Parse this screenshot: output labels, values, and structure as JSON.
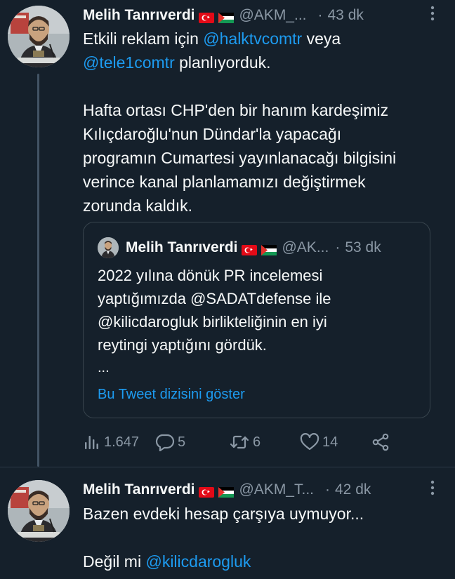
{
  "tweets": [
    {
      "author": {
        "name": "Melih Tanrıverdi",
        "flags": [
          "turkey-flag-icon",
          "palestine-flag-icon"
        ],
        "handle": "@AKM_...",
        "time": "43 dk"
      },
      "more_icon": "more-icon",
      "body": {
        "line1_pre": "Etkili reklam için ",
        "mention1": "@halktvcomtr",
        "line1_post": " veya",
        "mention2": "@tele1comtr",
        "line2_post": " planlıyorduk.",
        "paragraph2": [
          "Hafta ortası CHP'den bir hanım kardeşimiz",
          "Kılıçdaroğlu'nun Dündar'la yapacağı",
          "programın Cumartesi yayınlanacağı bilgisini",
          "verince kanal planlamamızı değiştirmek",
          "zorunda kaldık."
        ]
      },
      "quote": {
        "author": {
          "name": "Melih Tanrıverdi",
          "handle": "@AK...",
          "time": "53 dk"
        },
        "lines": [
          "2022 yılına dönük PR incelemesi",
          "yaptığımızda @SADATdefense ile",
          "@kilicdarogluk birlikteliğinin en iyi",
          "reytingi yaptığını gördük."
        ],
        "ellipsis": "...",
        "show_thread": "Bu Tweet dizisini göster"
      },
      "actions": {
        "views": {
          "icon": "views-icon",
          "count": "1.647"
        },
        "replies": {
          "icon": "reply-icon",
          "count": "5"
        },
        "retweets": {
          "icon": "retweet-icon",
          "count": "6"
        },
        "likes": {
          "icon": "like-icon",
          "count": "14"
        },
        "share": {
          "icon": "share-icon"
        }
      }
    },
    {
      "author": {
        "name": "Melih Tanrıverdi",
        "flags": [
          "turkey-flag-icon",
          "palestine-flag-icon"
        ],
        "handle": "@AKM_T...",
        "time": "42 dk"
      },
      "more_icon": "more-icon",
      "body": {
        "line1": "Bazen evdeki hesap çarşıya uymuyor...",
        "line2_pre": "Değil mi ",
        "mention": "@kilicdarogluk"
      }
    }
  ],
  "colors": {
    "background": "#15202b",
    "text": "#f7f9f9",
    "secondary_text": "#8b98a5",
    "link": "#1d9bf0",
    "border": "#38444d"
  }
}
